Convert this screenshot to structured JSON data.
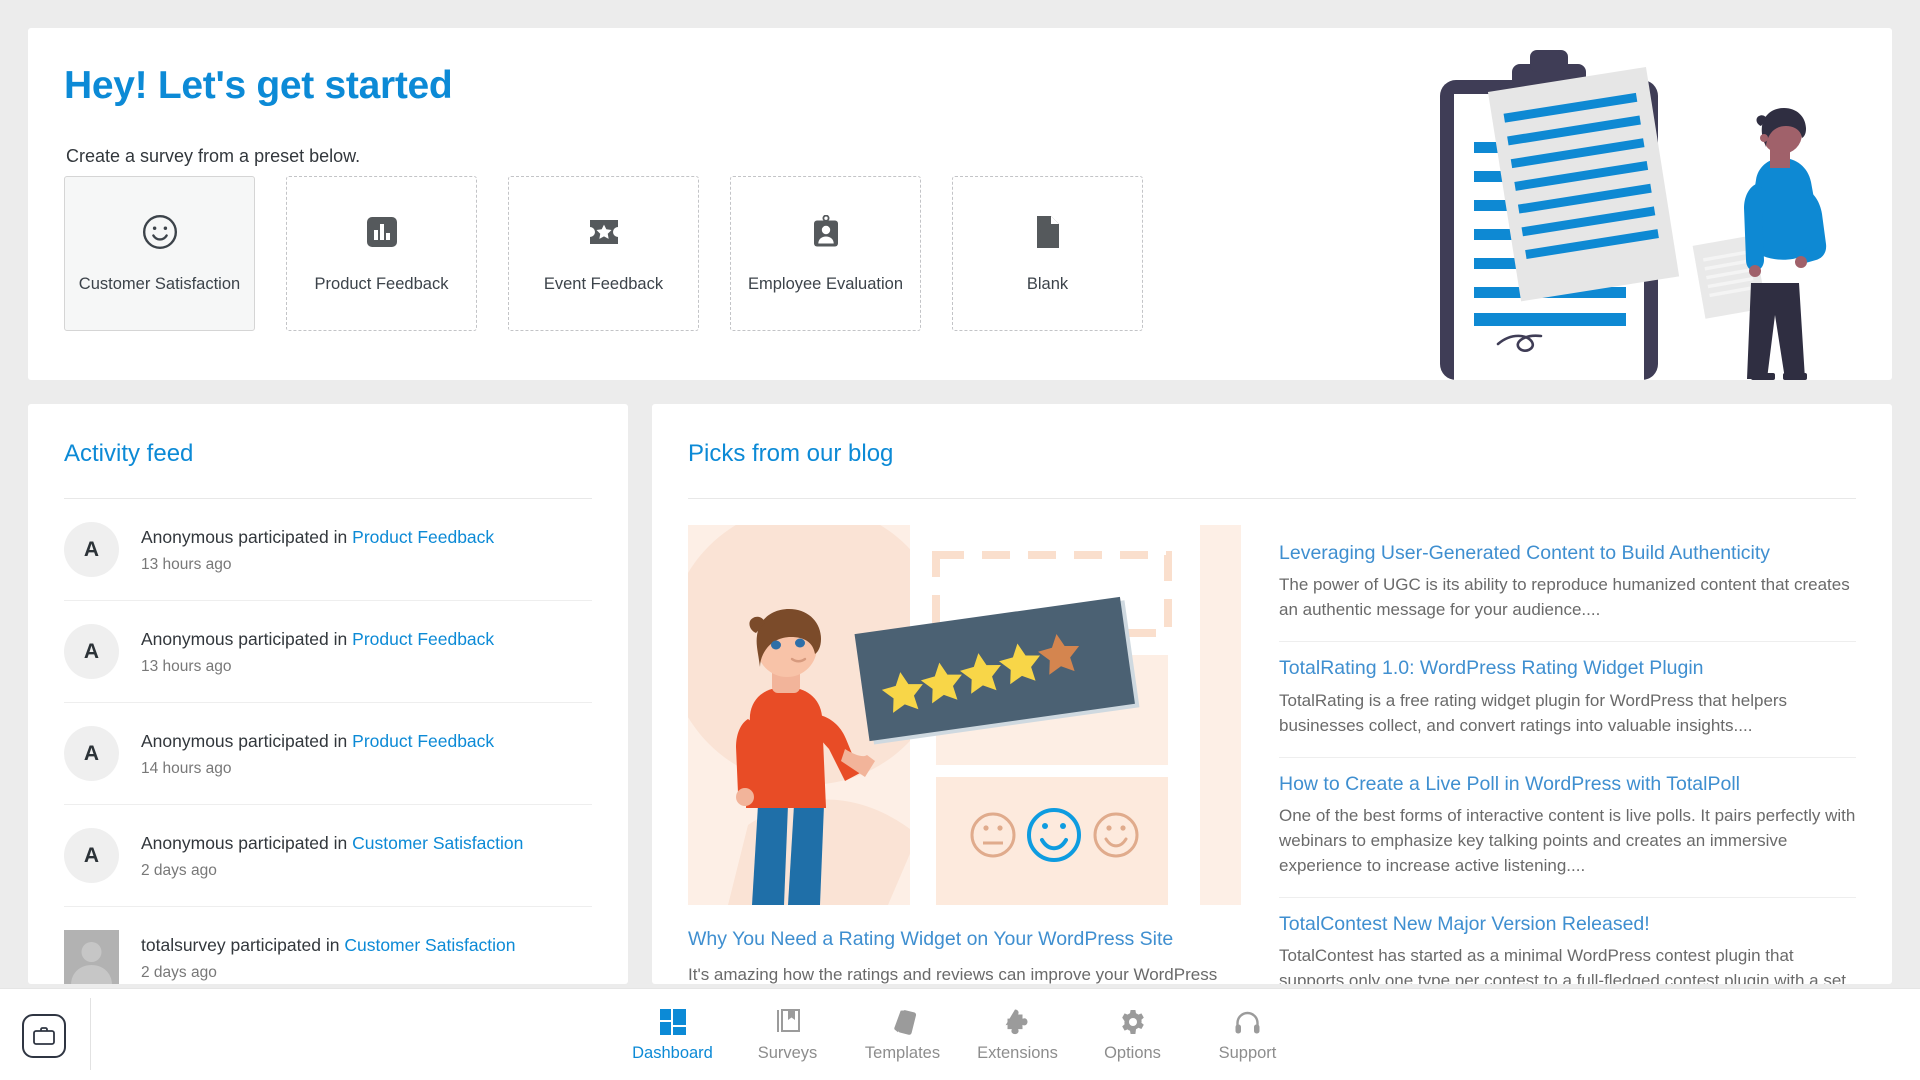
{
  "hero": {
    "title": "Hey! Let's get started",
    "subtitle": "Create a survey from a preset below.",
    "accent_color": "#0c8ad6",
    "presets": [
      {
        "label": "Customer Satisfaction",
        "icon": "smiley-icon",
        "state": "active"
      },
      {
        "label": "Product Feedback",
        "icon": "bar-chart-icon",
        "state": "default"
      },
      {
        "label": "Event Feedback",
        "icon": "ticket-star-icon",
        "state": "default"
      },
      {
        "label": "Employee Evaluation",
        "icon": "id-badge-icon",
        "state": "default"
      },
      {
        "label": "Blank",
        "icon": "blank-page-icon",
        "state": "default"
      }
    ],
    "illustration": "clipboard-and-person-illustration"
  },
  "activity_feed": {
    "title": "Activity feed",
    "items": [
      {
        "avatar": "A",
        "avatar_type": "initial",
        "user": "Anonymous",
        "verb": "participated in",
        "survey": "Product Feedback",
        "time": "13 hours ago"
      },
      {
        "avatar": "A",
        "avatar_type": "initial",
        "user": "Anonymous",
        "verb": "participated in",
        "survey": "Product Feedback",
        "time": "13 hours ago"
      },
      {
        "avatar": "A",
        "avatar_type": "initial",
        "user": "Anonymous",
        "verb": "participated in",
        "survey": "Product Feedback",
        "time": "14 hours ago"
      },
      {
        "avatar": "A",
        "avatar_type": "initial",
        "user": "Anonymous",
        "verb": "participated in",
        "survey": "Customer Satisfaction",
        "time": "2 days ago"
      },
      {
        "avatar": "",
        "avatar_type": "gravatar",
        "user": "totalsurvey",
        "verb": "participated in",
        "survey": "Customer Satisfaction",
        "time": "2 days ago"
      }
    ]
  },
  "blog": {
    "title": "Picks from our blog",
    "featured": {
      "image": "man-holding-star-rating-board-illustration",
      "title": "Why You Need a Rating Widget on Your WordPress Site",
      "excerpt": "It's amazing how the ratings and reviews can improve your WordPress website"
    },
    "posts": [
      {
        "title": "Leveraging User-Generated Content to Build Authenticity",
        "excerpt": "The power of UGC is its ability to reproduce humanized content that creates an authentic message for your audience...."
      },
      {
        "title": "TotalRating 1.0: WordPress Rating Widget Plugin",
        "excerpt": "TotalRating is a free rating widget plugin for WordPress that helpers businesses collect, and convert ratings into valuable insights...."
      },
      {
        "title": "How to Create a Live Poll in WordPress with TotalPoll",
        "excerpt": "One of the best forms of interactive content is live polls. It pairs perfectly with webinars to emphasize key talking points and creates an immersive experience to increase active listening...."
      },
      {
        "title": "TotalContest New Major Version Released!",
        "excerpt": "TotalContest has started as a minimal WordPress contest plugin that supports only one type per contest to a full-fledged contest plugin with a set of powerful features...."
      }
    ]
  },
  "bottom_nav": {
    "items": [
      {
        "label": "Dashboard",
        "icon": "dashboard-grid-icon",
        "state": "active"
      },
      {
        "label": "Surveys",
        "icon": "book-icon",
        "state": "default"
      },
      {
        "label": "Templates",
        "icon": "templates-icon",
        "state": "default"
      },
      {
        "label": "Extensions",
        "icon": "puzzle-piece-icon",
        "state": "default"
      },
      {
        "label": "Options",
        "icon": "gear-icon",
        "state": "default"
      },
      {
        "label": "Support",
        "icon": "headset-icon",
        "state": "default"
      }
    ],
    "briefcase_button": "briefcase-icon"
  }
}
